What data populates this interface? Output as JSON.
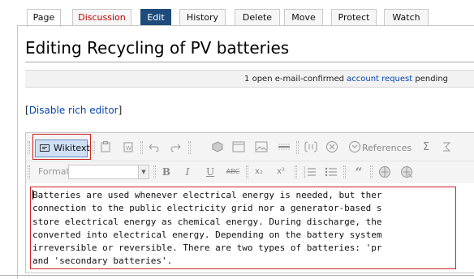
{
  "tabs": [
    {
      "label": "Page"
    },
    {
      "label": "Discussion"
    },
    {
      "label": "Edit"
    },
    {
      "label": "History"
    },
    {
      "label": "Delete"
    },
    {
      "label": "Move"
    },
    {
      "label": "Protect"
    },
    {
      "label": "Watch"
    }
  ],
  "page": {
    "title": "Editing Recycling of PV batteries"
  },
  "notice": {
    "prefix": "1 open e-mail-confirmed ",
    "link": "account request",
    "suffix": " pending"
  },
  "rich_editor": {
    "open_bracket": "[",
    "link": "Disable rich editor",
    "close_bracket": "]"
  },
  "toolbar": {
    "wikitext_label": "Wikitext",
    "references_label": "References",
    "format_label": "Format",
    "format_value": "",
    "bold": "B",
    "italic": "I",
    "underline": "U",
    "strike": "ABC",
    "subscript": "x₂",
    "superscript": "x²",
    "sigma": "Σ",
    "icons": [
      "paste-icon",
      "paste-word-icon",
      "undo-icon",
      "redo-icon",
      "template-icon",
      "table-icon",
      "image-icon",
      "horizontal-rule-icon",
      "magic-word-icon",
      "signature-icon",
      "references-icon",
      "sigma-icon",
      "numbered-list-icon",
      "bulleted-list-icon",
      "quote-icon",
      "link-icon",
      "unlink-icon"
    ]
  },
  "editor": {
    "lines": [
      "Batteries are used whenever electrical energy is needed, but ther",
      "connection to the public electricity grid nor a generator-based s",
      "store electrical energy as chemical energy. During discharge, the",
      "converted into electrical energy. Depending on the battery system",
      "irreversible or reversible. There are two types of batteries: 'pr",
      "and 'secondary batteries'."
    ]
  },
  "colors": {
    "edit_tab": "#1c4b7c",
    "discussion_tab_text": "#ba0000",
    "link": "#0645ad",
    "highlight_outline": "#cc2222",
    "wikitext_button_bg": "#cfe0f5"
  }
}
